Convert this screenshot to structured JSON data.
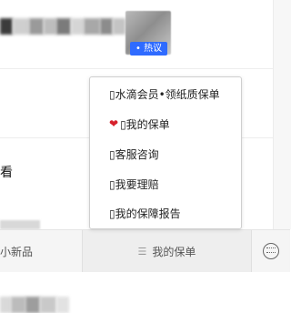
{
  "feed": {
    "hot_tag": "• 热议",
    "lead_char": "看",
    "colors": {
      "tag_blue": "#2f6bff"
    }
  },
  "tabbar": {
    "left_label": "小新品",
    "mine_label": "我的保单",
    "mine_icon": "menu-lines-icon",
    "right_icon": "keyboard-icon"
  },
  "popup": {
    "items": [
      {
        "label": "▯水滴会员•领纸质保单"
      },
      {
        "icon": "heart-icon",
        "label": "▯我的保单"
      },
      {
        "label": "▯客服咨询"
      },
      {
        "label": "▯我要理赔"
      },
      {
        "label": "▯我的保障报告"
      }
    ]
  }
}
